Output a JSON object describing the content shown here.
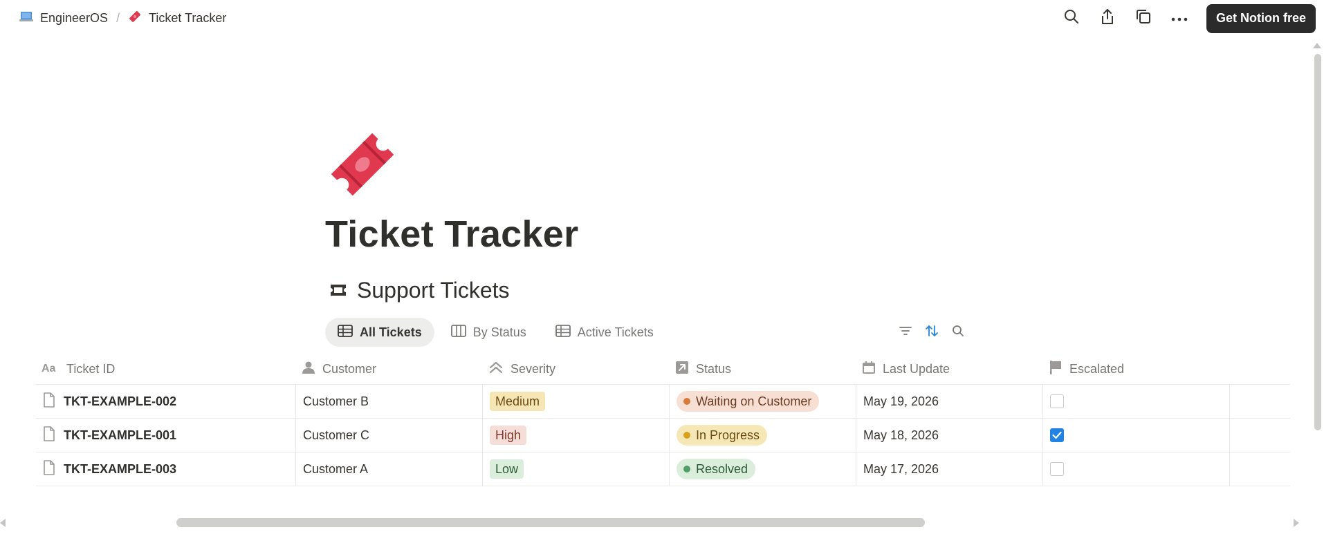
{
  "breadcrumb": {
    "workspace": "EngineerOS",
    "page": "Ticket Tracker"
  },
  "topbar": {
    "cta_label": "Get Notion free",
    "icons": [
      "search-icon",
      "share-icon",
      "duplicate-icon",
      "more-icon"
    ]
  },
  "page": {
    "title": "Ticket Tracker",
    "icon": "ticket-icon"
  },
  "database": {
    "title": "Support Tickets",
    "views": [
      {
        "label": "All Tickets",
        "icon": "table-icon",
        "active": true
      },
      {
        "label": "By Status",
        "icon": "board-icon",
        "active": false
      },
      {
        "label": "Active Tickets",
        "icon": "table-icon",
        "active": false
      }
    ],
    "columns": [
      {
        "label": "Ticket ID",
        "icon": "text-icon"
      },
      {
        "label": "Customer",
        "icon": "person-icon"
      },
      {
        "label": "Severity",
        "icon": "select-icon"
      },
      {
        "label": "Status",
        "icon": "status-icon"
      },
      {
        "label": "Last Update",
        "icon": "calendar-icon"
      },
      {
        "label": "Escalated",
        "icon": "flag-icon"
      }
    ],
    "rows": [
      {
        "id": "TKT-EXAMPLE-002",
        "customer": "Customer B",
        "severity": "Medium",
        "status": "Waiting on Customer",
        "last_update": "May 19, 2026",
        "escalated": false
      },
      {
        "id": "TKT-EXAMPLE-001",
        "customer": "Customer C",
        "severity": "High",
        "status": "In Progress",
        "last_update": "May 18, 2026",
        "escalated": true
      },
      {
        "id": "TKT-EXAMPLE-003",
        "customer": "Customer A",
        "severity": "Low",
        "status": "Resolved",
        "last_update": "May 17, 2026",
        "escalated": false
      }
    ]
  },
  "colors": {
    "accent": "#2383e2",
    "ticket_red": "#e0384f",
    "cta_bg": "#2b2b2b"
  }
}
